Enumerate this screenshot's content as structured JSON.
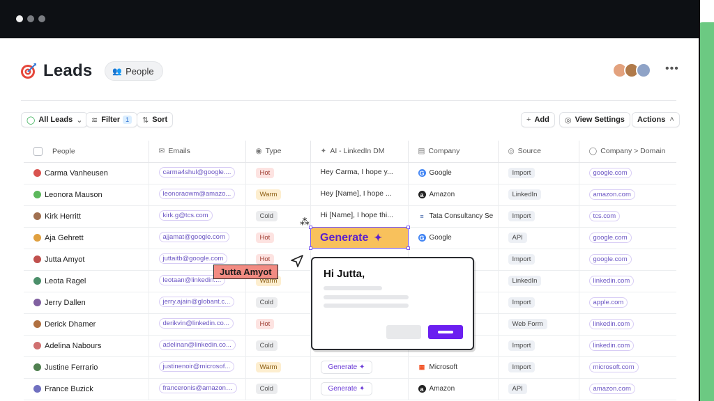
{
  "page": {
    "title": "Leads",
    "view_chip": "People"
  },
  "toolbar": {
    "all_leads": "All Leads",
    "filter": "Filter",
    "filter_count": "1",
    "sort": "Sort",
    "add": "Add",
    "view_settings": "View Settings",
    "actions": "Actions"
  },
  "table": {
    "headers": [
      "People",
      "Emails",
      "Type",
      "AI - LinkedIn DM",
      "Company",
      "Source",
      "Company > Domain"
    ],
    "rows": [
      {
        "name": "Carma Vanheusen",
        "email": "carma4shul@google....",
        "type": "Hot",
        "ai": "Hey Carma, I hope y...",
        "company": "Google",
        "source": "Import",
        "domain": "google.com"
      },
      {
        "name": "Leonora Mauson",
        "email": "leonoraowm@amazo...",
        "type": "Warm",
        "ai": "Hey [Name], I hope ...",
        "company": "Amazon",
        "source": "LinkedIn",
        "domain": "amazon.com"
      },
      {
        "name": "Kirk Herritt",
        "email": "kirk.g@tcs.com",
        "type": "Cold",
        "ai": "Hi [Name], I hope thi...",
        "company": "Tata Consultancy Se",
        "source": "Import",
        "domain": "tcs.com"
      },
      {
        "name": "Aja Gehrett",
        "email": "ajjamat@google.com",
        "type": "Hot",
        "ai": "",
        "company": "Google",
        "source": "API",
        "domain": "google.com"
      },
      {
        "name": "Jutta Amyot",
        "email": "juttaitb@google.com",
        "type": "Hot",
        "ai": "",
        "company": "",
        "source": "Import",
        "domain": "google.com"
      },
      {
        "name": "Leota Ragel",
        "email": "leotaan@linkedin....",
        "type": "Warm",
        "ai": "",
        "company": "",
        "source": "LinkedIn",
        "domain": "linkedin.com"
      },
      {
        "name": "Jerry Dallen",
        "email": "jerry.ajain@globant.c...",
        "type": "Cold",
        "ai": "",
        "company": "",
        "source": "Import",
        "domain": "apple.com"
      },
      {
        "name": "Derick Dhamer",
        "email": "derikvin@linkedin.co...",
        "type": "Hot",
        "ai": "",
        "company": "",
        "source": "Web Form",
        "domain": "linkedin.com"
      },
      {
        "name": "Adelina Nabours",
        "email": "adelinan@linkedin.co...",
        "type": "Cold",
        "ai": "",
        "company": "",
        "source": "Import",
        "domain": "linkedin.com"
      },
      {
        "name": "Justine Ferrario",
        "email": "justinenoir@microsof...",
        "type": "Warm",
        "ai": "Generate",
        "company": "Microsoft",
        "source": "Import",
        "domain": "microsoft.com"
      },
      {
        "name": "France Buzick",
        "email": "franceronis@amazon....",
        "type": "Cold",
        "ai": "Generate",
        "company": "Amazon",
        "source": "API",
        "domain": "amazon.com"
      }
    ]
  },
  "overlay": {
    "generate_label": "Generate",
    "cursor_name": "Jutta Amyot",
    "popup_greeting": "Hi Jutta,"
  },
  "colors": {
    "accent": "#6b1ff0",
    "highlight": "#f8c15c",
    "cursor_tag": "#f28b82",
    "side_accent": "#6cc982"
  }
}
